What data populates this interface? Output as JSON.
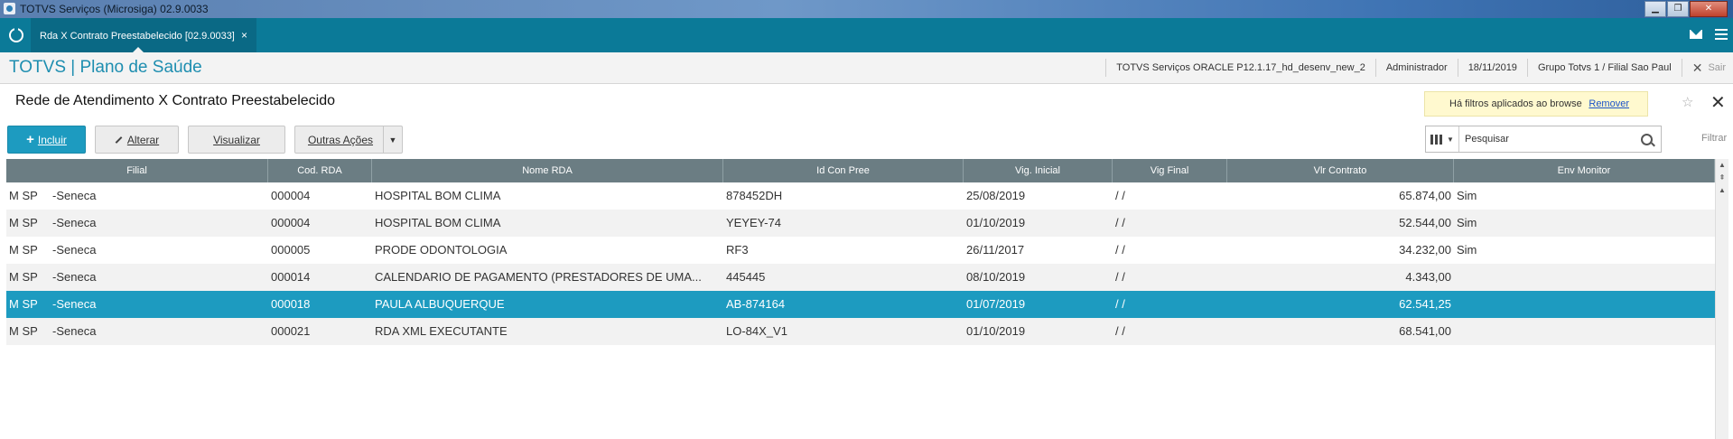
{
  "window": {
    "title": "TOTVS Serviços (Microsiga) 02.9.0033",
    "buttons": {
      "minimize": "▁",
      "maximize": "❐",
      "close": "✕"
    }
  },
  "tabbar": {
    "tab_label": "Rda X Contrato Preestabelecido [02.9.0033]",
    "tab_close": "×"
  },
  "header": {
    "brand": "TOTVS | Plano de Saúde",
    "environment": "TOTVS Serviços ORACLE P12.1.17_hd_desenv_new_2",
    "user": "Administrador",
    "date": "18/11/2019",
    "branch": "Grupo Totvs 1 / Filial Sao Paul",
    "exit_label": "Sair"
  },
  "page": {
    "title": "Rede de Atendimento X Contrato Preestabelecido",
    "filter_notice": "Há filtros aplicados ao browse",
    "filter_remove": "Remover",
    "close_glyph": "✕"
  },
  "toolbar": {
    "incluir": "Incluir",
    "alterar": "Alterar",
    "visualizar": "Visualizar",
    "outras": "Outras Ações"
  },
  "search": {
    "placeholder": "Pesquisar",
    "filter_label": "Filtrar"
  },
  "grid": {
    "columns": [
      "Filial",
      "Cod. RDA",
      "Nome RDA",
      "Id Con Pree",
      "Vig. Inicial",
      "Vig Final",
      "Vlr Contrato",
      "Env Monitor"
    ],
    "rows": [
      {
        "filial_code": "M SP",
        "filial_name": "-Seneca",
        "cod_rda": "000004",
        "nome_rda": "HOSPITAL BOM CLIMA",
        "id_con_pree": "878452DH",
        "vig_inicial": "25/08/2019",
        "vig_final": " /  /",
        "vlr_contrato": "65.874,00",
        "env_monitor": "Sim"
      },
      {
        "filial_code": "M SP",
        "filial_name": "-Seneca",
        "cod_rda": "000004",
        "nome_rda": "HOSPITAL BOM CLIMA",
        "id_con_pree": "YEYEY-74",
        "vig_inicial": "01/10/2019",
        "vig_final": " /  /",
        "vlr_contrato": "52.544,00",
        "env_monitor": "Sim"
      },
      {
        "filial_code": "M SP",
        "filial_name": "-Seneca",
        "cod_rda": "000005",
        "nome_rda": "PRODE ODONTOLOGIA",
        "id_con_pree": "RF3",
        "vig_inicial": "26/11/2017",
        "vig_final": " /  /",
        "vlr_contrato": "34.232,00",
        "env_monitor": "Sim"
      },
      {
        "filial_code": "M SP",
        "filial_name": "-Seneca",
        "cod_rda": "000014",
        "nome_rda": "CALENDARIO DE PAGAMENTO (PRESTADORES DE UMA...",
        "id_con_pree": "445445",
        "vig_inicial": "08/10/2019",
        "vig_final": " /  /",
        "vlr_contrato": "4.343,00",
        "env_monitor": ""
      },
      {
        "filial_code": "M SP",
        "filial_name": "-Seneca",
        "cod_rda": "000018",
        "nome_rda": "PAULA ALBUQUERQUE",
        "id_con_pree": "AB-874164",
        "vig_inicial": "01/07/2019",
        "vig_final": " /  /",
        "vlr_contrato": "62.541,25",
        "env_monitor": ""
      },
      {
        "filial_code": "M SP",
        "filial_name": "-Seneca",
        "cod_rda": "000021",
        "nome_rda": "RDA XML EXECUTANTE",
        "id_con_pree": "LO-84X_V1",
        "vig_inicial": "01/10/2019",
        "vig_final": " /  /",
        "vlr_contrato": "68.541,00",
        "env_monitor": ""
      }
    ],
    "selected_row": 4
  },
  "colors": {
    "accent": "#1d9bc0",
    "tabbar": "#0b7a98",
    "grid_header": "#6b7d83",
    "notice_bg": "#fff9cf"
  }
}
